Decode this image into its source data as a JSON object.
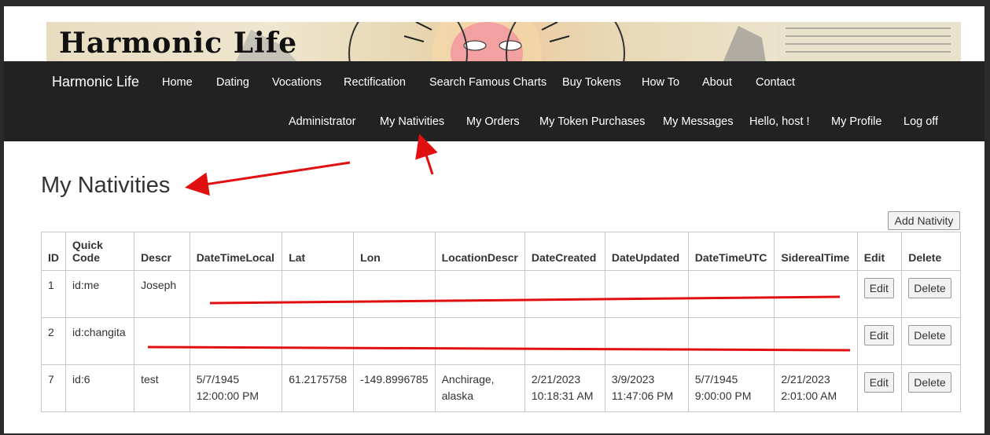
{
  "banner": {
    "logo_text": "Harmonic Life"
  },
  "navbar": {
    "brand": "Harmonic Life",
    "primary_items": [
      "Home",
      "Dating",
      "Vocations",
      "Rectification",
      "Search Famous Charts",
      "Buy Tokens",
      "How To",
      "About",
      "Contact"
    ],
    "secondary_items": [
      "Administrator",
      "My Nativities",
      "My Orders",
      "My Token Purchases",
      "My Messages",
      "Hello, host !",
      "My Profile",
      "Log off"
    ]
  },
  "page": {
    "title": "My Nativities",
    "add_button": "Add Nativity"
  },
  "table": {
    "headers": [
      "ID",
      "Quick Code",
      "Descr",
      "DateTimeLocal",
      "Lat",
      "Lon",
      "LocationDescr",
      "DateCreated",
      "DateUpdated",
      "DateTimeUTC",
      "SiderealTime",
      "Edit",
      "Delete"
    ],
    "rows": [
      {
        "id": "1",
        "quick_code": "id:me",
        "descr": "Joseph",
        "date_time_local": "",
        "lat": "",
        "lon": "",
        "location_descr": "",
        "date_created": "",
        "date_updated": "",
        "date_time_utc": "",
        "sidereal_time": "",
        "edit": "Edit",
        "delete": "Delete"
      },
      {
        "id": "2",
        "quick_code": "id:changita",
        "descr": "",
        "date_time_local": "",
        "lat": "",
        "lon": "",
        "location_descr": "",
        "date_created": "",
        "date_updated": "",
        "date_time_utc": "",
        "sidereal_time": "",
        "edit": "Edit",
        "delete": "Delete"
      },
      {
        "id": "7",
        "quick_code": "id:6",
        "descr": "test",
        "date_time_local": "5/7/1945 12:00:00 PM",
        "lat": "61.2175758",
        "lon": "-149.8996785",
        "location_descr": "Anchirage, alaska",
        "date_created": "2/21/2023 10:18:31 AM",
        "date_updated": "3/9/2023 11:47:06 PM",
        "date_time_utc": "5/7/1945 9:00:00 PM",
        "sidereal_time": "2/21/2023 2:01:00 AM",
        "edit": "Edit",
        "delete": "Delete"
      }
    ]
  },
  "colors": {
    "navbar_bg": "#222222",
    "annotation_red": "#e01010"
  }
}
